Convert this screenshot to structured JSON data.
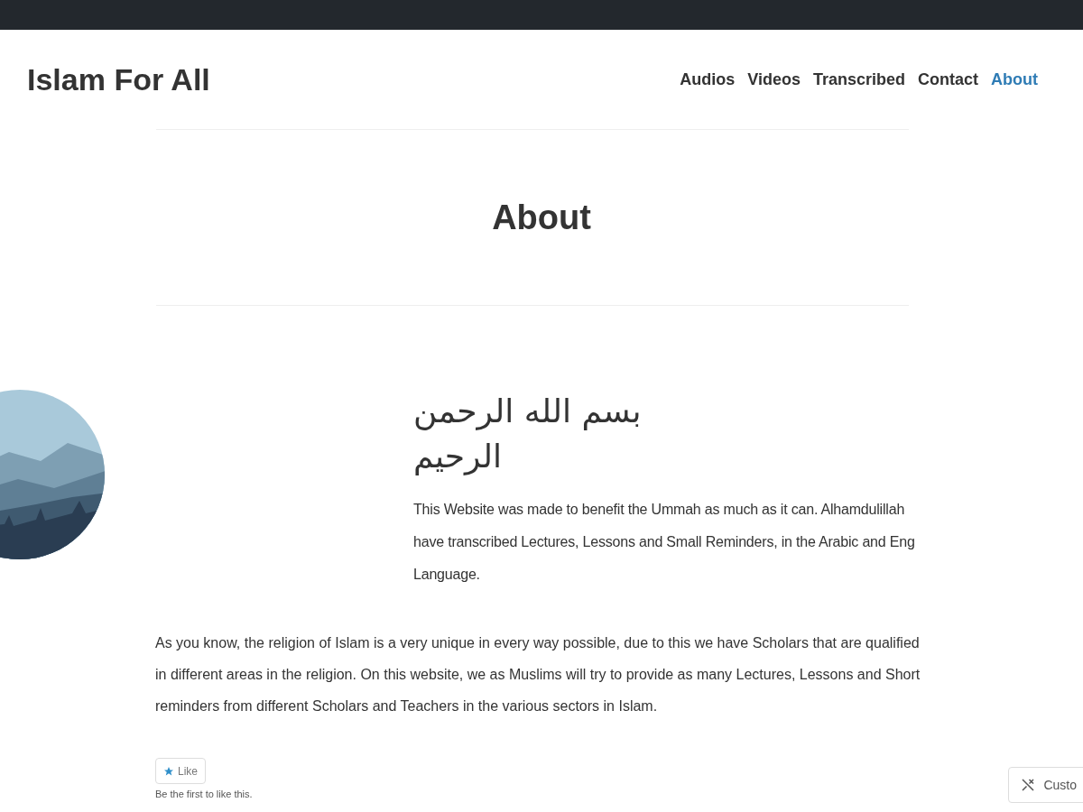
{
  "site_title": "Islam For All",
  "nav": [
    {
      "label": "Audios",
      "selected": false
    },
    {
      "label": "Videos",
      "selected": false
    },
    {
      "label": "Transcribed",
      "selected": false
    },
    {
      "label": "Contact",
      "selected": false
    },
    {
      "label": "About",
      "selected": true
    }
  ],
  "page_title": "About",
  "heading": "بسم الله الرحمن الرحيم",
  "intro_lines": [
    "This Website was made to benefit the Ummah as much as it can. Alhamdulillah",
    "have transcribed Lectures, Lessons and Small Reminders, in the Arabic and Eng",
    "Language."
  ],
  "body": "As you know, the religion of Islam is a very unique in every way possible, due to this we have Scholars that are qualified in different areas in the religion. On this website, we as Muslims will try to provide as many Lectures, Lessons and Short reminders from different Scholars and Teachers in the various sectors in Islam.",
  "like_button": "Like",
  "like_note": "Be the first to like this.",
  "customize_button": "Custo"
}
